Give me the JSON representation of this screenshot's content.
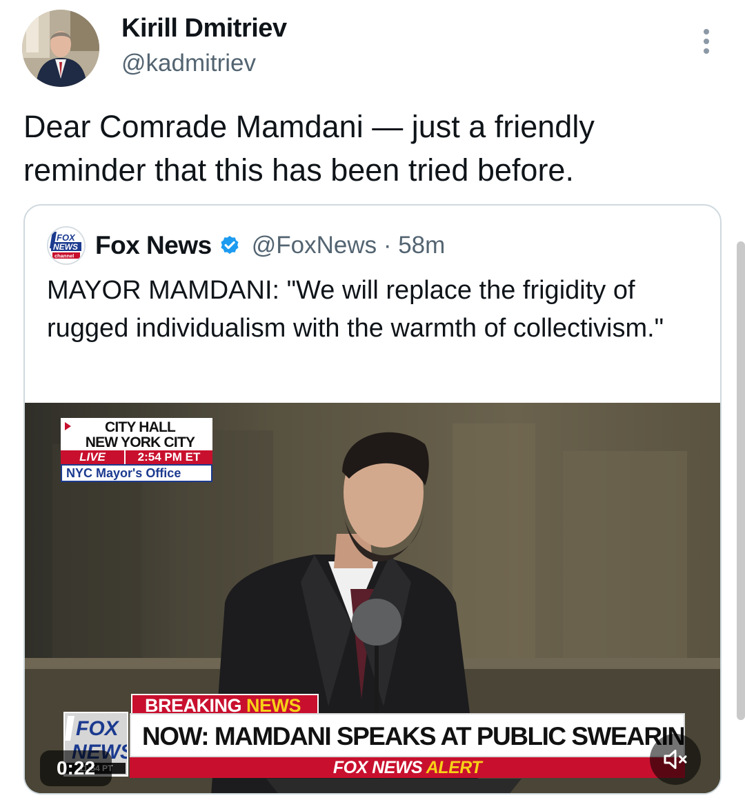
{
  "author": {
    "name": "Kirill Dmitriev",
    "handle": "@kadmitriev"
  },
  "tweet": {
    "text": "Dear Comrade Mamdani — just a friendly reminder that this has been tried before."
  },
  "quoted": {
    "name": "Fox News",
    "handle": "@FoxNews · 58m",
    "text": "MAYOR MAMDANI: \"We will replace the frigidity of rugged individualism with the warmth of collectivism.\"",
    "logo_lines": [
      "FOX",
      "NEWS",
      "channel"
    ]
  },
  "video": {
    "location_line1": "CITY HALL",
    "location_line2": "NEW YORK CITY",
    "live_label": "LIVE",
    "live_time": "2:54 PM ET",
    "source": "NYC Mayor's Office",
    "breaking_label": "BREAKING",
    "breaking_news_word": "NEWS",
    "headline": "NOW: MAMDANI SPEAKS AT PUBLIC SWEARING-IN CEREMONY",
    "alert_prefix": "FOX NEWS",
    "alert_word": "ALERT",
    "bug_lines": [
      "FOX",
      "NEWS"
    ],
    "bug_time": "11:54 PT",
    "elapsed": "0:22"
  },
  "icons": {
    "more": "more-vertical-icon",
    "verified": "verified-badge-icon",
    "mute": "speaker-muted-icon"
  },
  "colors": {
    "verified_blue": "#1d9bf0",
    "fox_red": "#c8102e",
    "fox_yellow": "#f7d117",
    "fox_blue": "#1b3a8f"
  }
}
